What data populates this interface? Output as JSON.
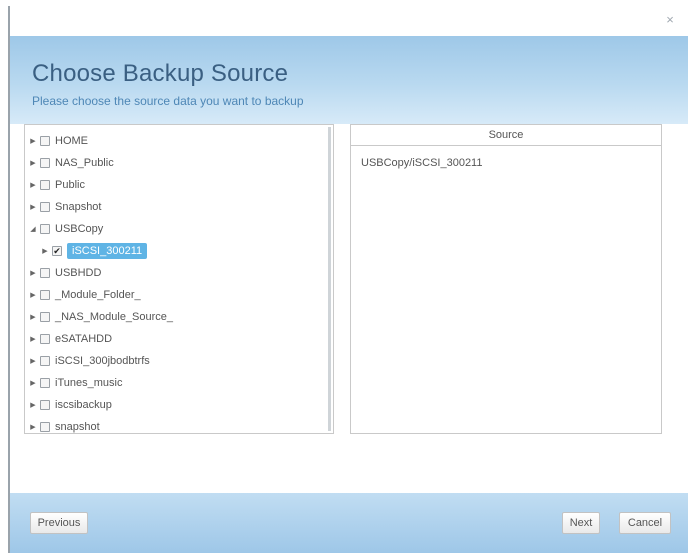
{
  "dialog": {
    "close_glyph": "×",
    "title": "Choose Backup Source",
    "subtitle": "Please choose the source data you want to backup"
  },
  "tree": {
    "items": [
      {
        "label": "HOME",
        "level": 0,
        "checked": false,
        "selected": false
      },
      {
        "label": "NAS_Public",
        "level": 0,
        "checked": false,
        "selected": false
      },
      {
        "label": "Public",
        "level": 0,
        "checked": false,
        "selected": false
      },
      {
        "label": "Snapshot",
        "level": 0,
        "checked": false,
        "selected": false
      },
      {
        "label": "USBCopy",
        "level": 0,
        "checked": false,
        "selected": false,
        "expanded": true
      },
      {
        "label": "iSCSI_300211",
        "level": 1,
        "checked": true,
        "selected": true
      },
      {
        "label": "USBHDD",
        "level": 0,
        "checked": false,
        "selected": false
      },
      {
        "label": "_Module_Folder_",
        "level": 0,
        "checked": false,
        "selected": false
      },
      {
        "label": "_NAS_Module_Source_",
        "level": 0,
        "checked": false,
        "selected": false
      },
      {
        "label": "eSATAHDD",
        "level": 0,
        "checked": false,
        "selected": false
      },
      {
        "label": "iSCSI_300jbodbtrfs",
        "level": 0,
        "checked": false,
        "selected": false
      },
      {
        "label": "iTunes_music",
        "level": 0,
        "checked": false,
        "selected": false
      },
      {
        "label": "iscsibackup",
        "level": 0,
        "checked": false,
        "selected": false
      },
      {
        "label": "snapshot",
        "level": 0,
        "checked": false,
        "selected": false
      }
    ]
  },
  "source": {
    "header": "Source",
    "items": [
      "USBCopy/iSCSI_300211"
    ]
  },
  "footer": {
    "previous_label": "Previous",
    "next_label": "Next",
    "cancel_label": "Cancel"
  }
}
